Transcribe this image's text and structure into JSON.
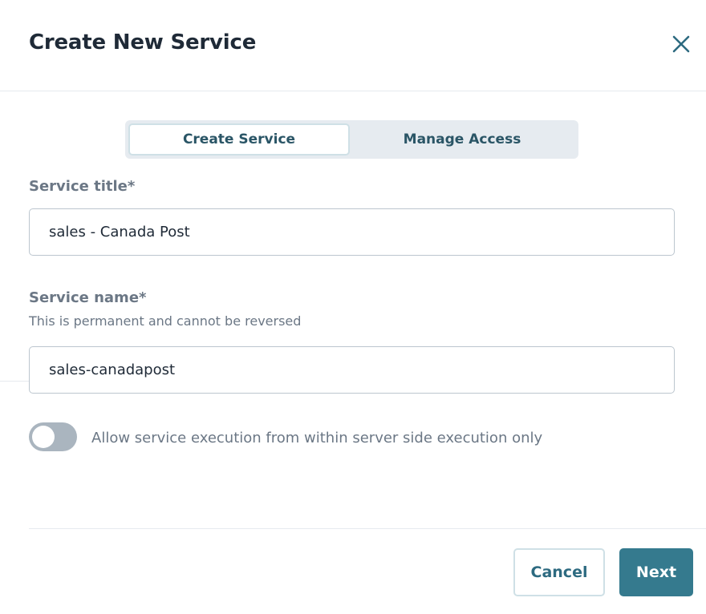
{
  "dialog": {
    "title": "Create New Service"
  },
  "tabs": [
    {
      "label": "Create Service",
      "active": true
    },
    {
      "label": "Manage Access",
      "active": false
    }
  ],
  "fields": {
    "service_title": {
      "label": "Service title*",
      "value": "sales - Canada Post"
    },
    "service_name": {
      "label": "Service name*",
      "hint": "This is permanent and cannot be reversed",
      "value": "sales-canadapost"
    }
  },
  "toggle": {
    "label": "Allow service execution from within server side execution only",
    "checked": false
  },
  "footer": {
    "cancel_label": "Cancel",
    "next_label": "Next"
  },
  "colors": {
    "accent": "#357a8e",
    "tab_text": "#2a5566",
    "muted_text": "#6b7785",
    "toggle_off": "#aab5bf"
  },
  "icons": {
    "close": "close-icon"
  }
}
